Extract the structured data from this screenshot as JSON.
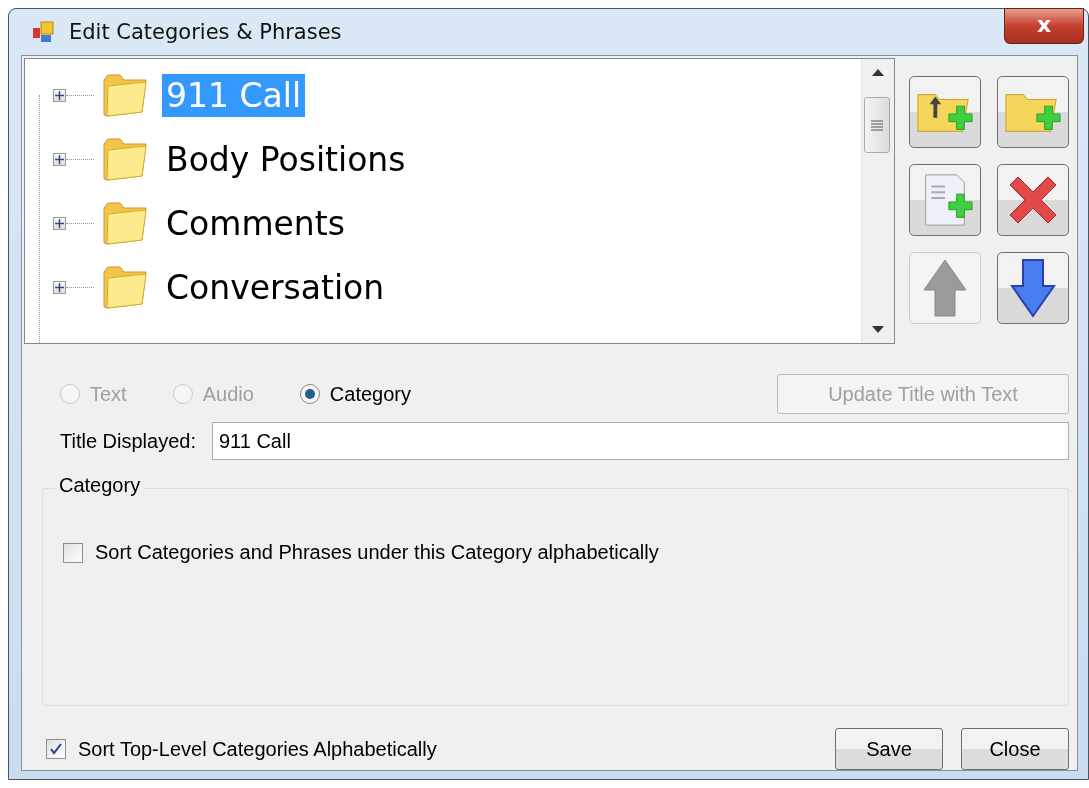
{
  "window": {
    "title": "Edit Categories & Phrases",
    "close_label": "x"
  },
  "tree": {
    "items": [
      {
        "label": "911 Call",
        "selected": true,
        "expanded": false
      },
      {
        "label": "Body Positions",
        "selected": false,
        "expanded": false
      },
      {
        "label": "Comments",
        "selected": false,
        "expanded": false
      },
      {
        "label": "Conversation",
        "selected": false,
        "expanded": false
      }
    ]
  },
  "toolbar": [
    {
      "kind": "add-top-category",
      "disabled": false
    },
    {
      "kind": "add-category",
      "disabled": false
    },
    {
      "kind": "add-phrase",
      "disabled": false
    },
    {
      "kind": "delete",
      "disabled": false
    },
    {
      "kind": "move-up",
      "disabled": true
    },
    {
      "kind": "move-down",
      "disabled": false
    }
  ],
  "type_options": [
    {
      "label": "Text",
      "selected": false,
      "disabled": true
    },
    {
      "label": "Audio",
      "selected": false,
      "disabled": true
    },
    {
      "label": "Category",
      "selected": true,
      "disabled": false
    }
  ],
  "update_button": {
    "label": "Update Title with Text",
    "disabled": true
  },
  "title_field": {
    "label": "Title Displayed:",
    "value": "911 Call"
  },
  "group": {
    "title": "Category",
    "checkbox": {
      "label": "Sort Categories and Phrases under this Category alphabetically",
      "checked": false
    }
  },
  "sort_top_level": {
    "label": "Sort Top-Level Categories Alphabetically",
    "checked": true
  },
  "buttons": [
    {
      "label": "Save"
    },
    {
      "label": "Close"
    }
  ]
}
